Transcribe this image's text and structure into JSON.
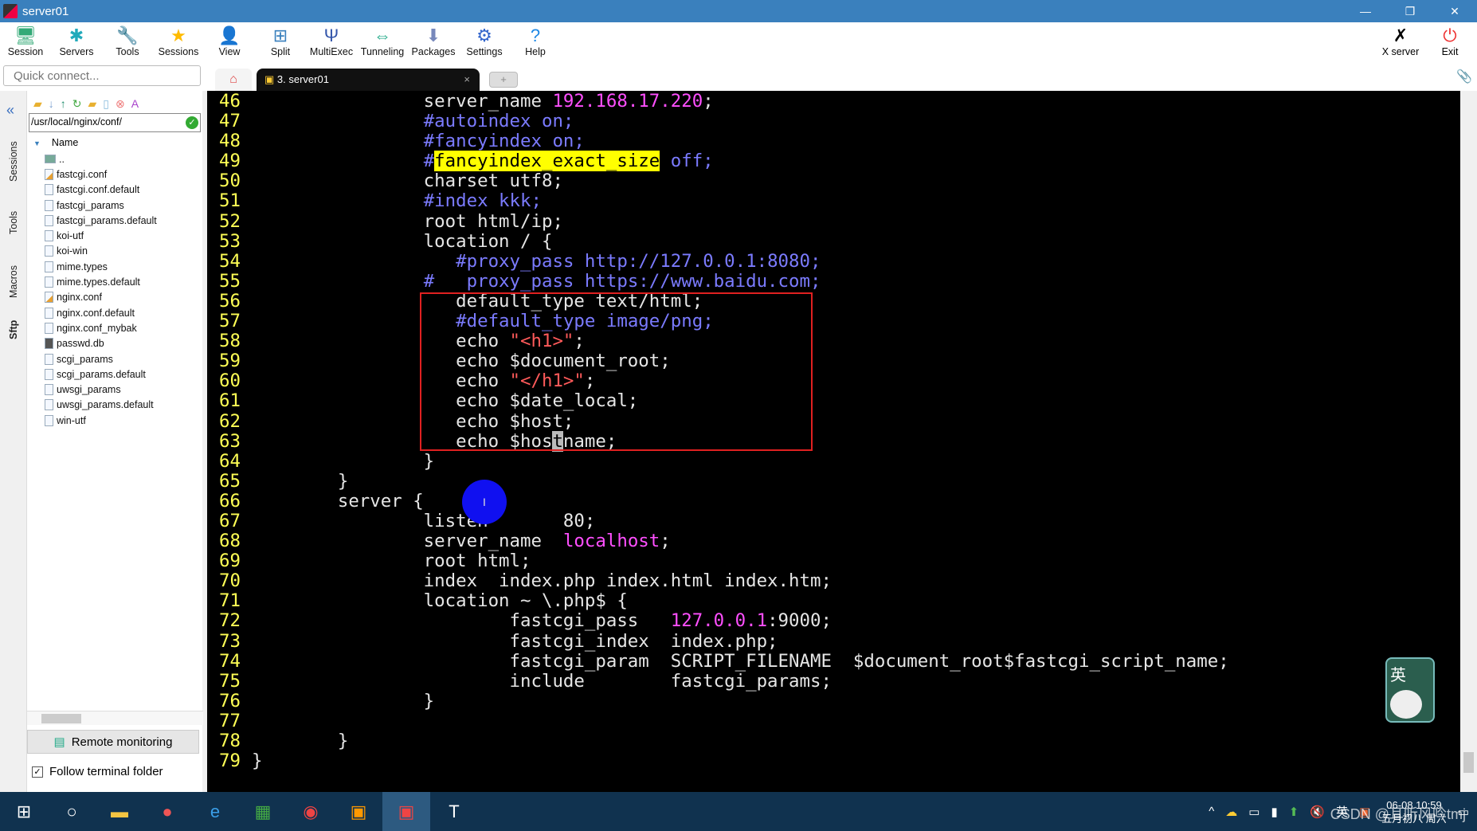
{
  "window": {
    "title": "server01",
    "minimize": "—",
    "restore": "❐",
    "close": "✕"
  },
  "toolbar": [
    {
      "label": "Session",
      "icon": "session-monitor-icon",
      "glyph": "🖥"
    },
    {
      "label": "Servers",
      "icon": "servers-network-icon",
      "glyph": "✱"
    },
    {
      "label": "Tools",
      "icon": "tools-knife-icon",
      "glyph": "🔧"
    },
    {
      "label": "Sessions",
      "icon": "star-icon",
      "glyph": "★"
    },
    {
      "label": "View",
      "icon": "view-person-icon",
      "glyph": "👤"
    },
    {
      "label": "Split",
      "icon": "split-icon",
      "glyph": "⊞"
    },
    {
      "label": "MultiExec",
      "icon": "multiexec-fork-icon",
      "glyph": "Ψ"
    },
    {
      "label": "Tunneling",
      "icon": "tunneling-icon",
      "glyph": "⇔"
    },
    {
      "label": "Packages",
      "icon": "packages-icon",
      "glyph": "⬇"
    },
    {
      "label": "Settings",
      "icon": "gears-icon",
      "glyph": "⚙"
    },
    {
      "label": "Help",
      "icon": "help-icon",
      "glyph": "?"
    }
  ],
  "toolbar_right": {
    "xserver": "X server",
    "exit": "Exit"
  },
  "quick_connect": {
    "placeholder": "Quick connect..."
  },
  "tabs": {
    "terminal": "3. server01",
    "close": "×",
    "new": "+"
  },
  "side_tabs": {
    "sessions": "Sessions",
    "tools": "Tools",
    "macros": "Macros",
    "sftp": "Sftp"
  },
  "sftp": {
    "path": "/usr/local/nginx/conf/",
    "column": "Name",
    "files": [
      {
        "name": "..",
        "type": "up"
      },
      {
        "name": "fastcgi.conf",
        "type": "edit"
      },
      {
        "name": "fastcgi.conf.default",
        "type": "file"
      },
      {
        "name": "fastcgi_params",
        "type": "file"
      },
      {
        "name": "fastcgi_params.default",
        "type": "file"
      },
      {
        "name": "koi-utf",
        "type": "file"
      },
      {
        "name": "koi-win",
        "type": "file"
      },
      {
        "name": "mime.types",
        "type": "file"
      },
      {
        "name": "mime.types.default",
        "type": "file"
      },
      {
        "name": "nginx.conf",
        "type": "edit"
      },
      {
        "name": "nginx.conf.default",
        "type": "file"
      },
      {
        "name": "nginx.conf_mybak",
        "type": "file"
      },
      {
        "name": "passwd.db",
        "type": "db"
      },
      {
        "name": "scgi_params",
        "type": "file"
      },
      {
        "name": "scgi_params.default",
        "type": "file"
      },
      {
        "name": "uwsgi_params",
        "type": "file"
      },
      {
        "name": "uwsgi_params.default",
        "type": "file"
      },
      {
        "name": "win-utf",
        "type": "file"
      }
    ],
    "remote_monitoring": "Remote monitoring",
    "follow_folder": "Follow terminal folder",
    "follow_checked": true
  },
  "colors": {
    "comment": "#7b7bff",
    "string": "#ff5a5a",
    "literal": "#ff4fff",
    "line_number": "#ffff55",
    "highlight": "#ffff00",
    "annotation_box": "#e02020"
  },
  "code": [
    {
      "n": "46",
      "s": [
        [
          "                server_name ",
          ""
        ],
        [
          "192.168.17.220",
          "ip"
        ],
        [
          ";",
          ""
        ]
      ]
    },
    {
      "n": "47",
      "s": [
        [
          "                ",
          ""
        ],
        [
          "#autoindex on;",
          "cm"
        ]
      ]
    },
    {
      "n": "48",
      "s": [
        [
          "                ",
          ""
        ],
        [
          "#fancyindex on;",
          "cm"
        ]
      ]
    },
    {
      "n": "49",
      "s": [
        [
          "                ",
          ""
        ],
        [
          "#",
          "cm"
        ],
        [
          "fancyindex_exact_size",
          "hl"
        ],
        [
          " off;",
          "cm"
        ]
      ]
    },
    {
      "n": "50",
      "s": [
        [
          "                charset utf8;",
          ""
        ]
      ]
    },
    {
      "n": "51",
      "s": [
        [
          "                ",
          ""
        ],
        [
          "#index kkk;",
          "cm"
        ]
      ]
    },
    {
      "n": "52",
      "s": [
        [
          "                root html/ip;",
          ""
        ]
      ]
    },
    {
      "n": "53",
      "s": [
        [
          "                location / {",
          ""
        ]
      ]
    },
    {
      "n": "54",
      "s": [
        [
          "                   ",
          ""
        ],
        [
          "#proxy_pass http://127.0.0.1:8080;",
          "cm"
        ]
      ]
    },
    {
      "n": "55",
      "s": [
        [
          "                ",
          ""
        ],
        [
          "#   proxy_pass https://www.baidu.com;",
          "cm"
        ]
      ]
    },
    {
      "n": "56",
      "s": [
        [
          "                   default_type text/html;",
          ""
        ]
      ]
    },
    {
      "n": "57",
      "s": [
        [
          "                   ",
          ""
        ],
        [
          "#default_type image/png;",
          "cm"
        ]
      ]
    },
    {
      "n": "58",
      "s": [
        [
          "                   echo ",
          ""
        ],
        [
          "\"<h1>\"",
          "str"
        ],
        [
          ";",
          ""
        ]
      ]
    },
    {
      "n": "59",
      "s": [
        [
          "                   echo $document_root;",
          ""
        ]
      ]
    },
    {
      "n": "60",
      "s": [
        [
          "                   echo ",
          ""
        ],
        [
          "\"</h1>\"",
          "str"
        ],
        [
          ";",
          ""
        ]
      ]
    },
    {
      "n": "61",
      "s": [
        [
          "                   echo $date_local;",
          ""
        ]
      ]
    },
    {
      "n": "62",
      "s": [
        [
          "                   echo $host;",
          ""
        ]
      ]
    },
    {
      "n": "63",
      "s": [
        [
          "                   echo $hos",
          ""
        ],
        [
          "t",
          "cur"
        ],
        [
          "name;",
          ""
        ]
      ]
    },
    {
      "n": "64",
      "s": [
        [
          "                }",
          ""
        ]
      ]
    },
    {
      "n": "65",
      "s": [
        [
          "        }",
          ""
        ]
      ]
    },
    {
      "n": "66",
      "s": [
        [
          "        server {",
          ""
        ]
      ]
    },
    {
      "n": "67",
      "s": [
        [
          "                listen       80;",
          ""
        ]
      ]
    },
    {
      "n": "68",
      "s": [
        [
          "                server_name  ",
          ""
        ],
        [
          "localhost",
          "ip"
        ],
        [
          ";",
          ""
        ]
      ]
    },
    {
      "n": "69",
      "s": [
        [
          "                root html;",
          ""
        ]
      ]
    },
    {
      "n": "70",
      "s": [
        [
          "                index  index.php index.html index.htm;",
          ""
        ]
      ]
    },
    {
      "n": "71",
      "s": [
        [
          "                location ~ \\.php$ {",
          ""
        ]
      ]
    },
    {
      "n": "72",
      "s": [
        [
          "                        fastcgi_pass   ",
          ""
        ],
        [
          "127.0.0.1",
          "ip"
        ],
        [
          ":9000;",
          ""
        ]
      ]
    },
    {
      "n": "73",
      "s": [
        [
          "                        fastcgi_index  index.php;",
          ""
        ]
      ]
    },
    {
      "n": "74",
      "s": [
        [
          "                        fastcgi_param  SCRIPT_FILENAME  $document_root$fastcgi_script_name;",
          ""
        ]
      ]
    },
    {
      "n": "75",
      "s": [
        [
          "                        include        fastcgi_params;",
          ""
        ]
      ]
    },
    {
      "n": "76",
      "s": [
        [
          "                }",
          ""
        ]
      ]
    },
    {
      "n": "77",
      "s": [
        [
          "",
          ""
        ]
      ]
    },
    {
      "n": "78",
      "s": [
        [
          "        }",
          ""
        ]
      ]
    },
    {
      "n": "79",
      "s": [
        [
          "}",
          ""
        ]
      ]
    }
  ],
  "ime": {
    "label": "英"
  },
  "taskbar": {
    "ime": "英",
    "time": "06-08 10:59",
    "date": "五月初八 周六",
    "watermark": "CSDN @耳听风吟tmj"
  }
}
